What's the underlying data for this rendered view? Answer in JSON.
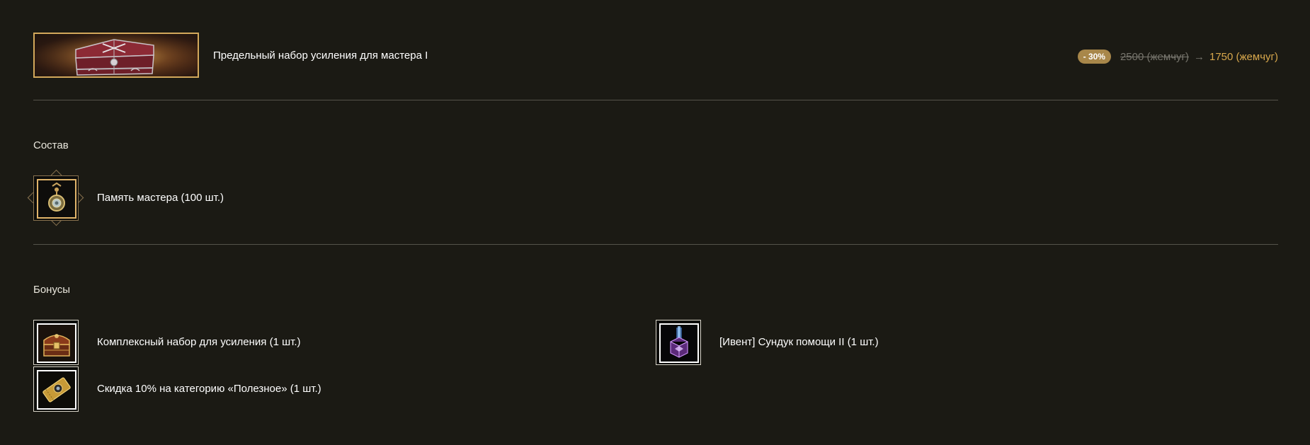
{
  "product": {
    "title": "Предельный набор усиления для мастера I",
    "discount": "- 30%",
    "old_price": "2500 (жемчуг)",
    "arrow": "→",
    "new_price": "1750 (жемчуг)",
    "thumb_icon": "treasure-chest"
  },
  "composition": {
    "title": "Состав",
    "items": [
      {
        "label": "Память мастера (100 шт.)",
        "icon": "pendant-amulet"
      }
    ]
  },
  "bonuses": {
    "title": "Бонусы",
    "items": [
      {
        "label": "Комплексный набор для усиления (1 шт.)",
        "icon": "treasure-chest"
      },
      {
        "label": "[Ивент] Сундук помощи II (1 шт.)",
        "icon": "purple-crystal-box"
      },
      {
        "label": "Скидка 10% на категорию «Полезное» (1 шт.)",
        "icon": "golden-coupon"
      }
    ]
  },
  "colors": {
    "background": "#1b1a14",
    "accent_gold": "#d7a74c",
    "badge": "#a8874a",
    "divider": "#55534a"
  }
}
